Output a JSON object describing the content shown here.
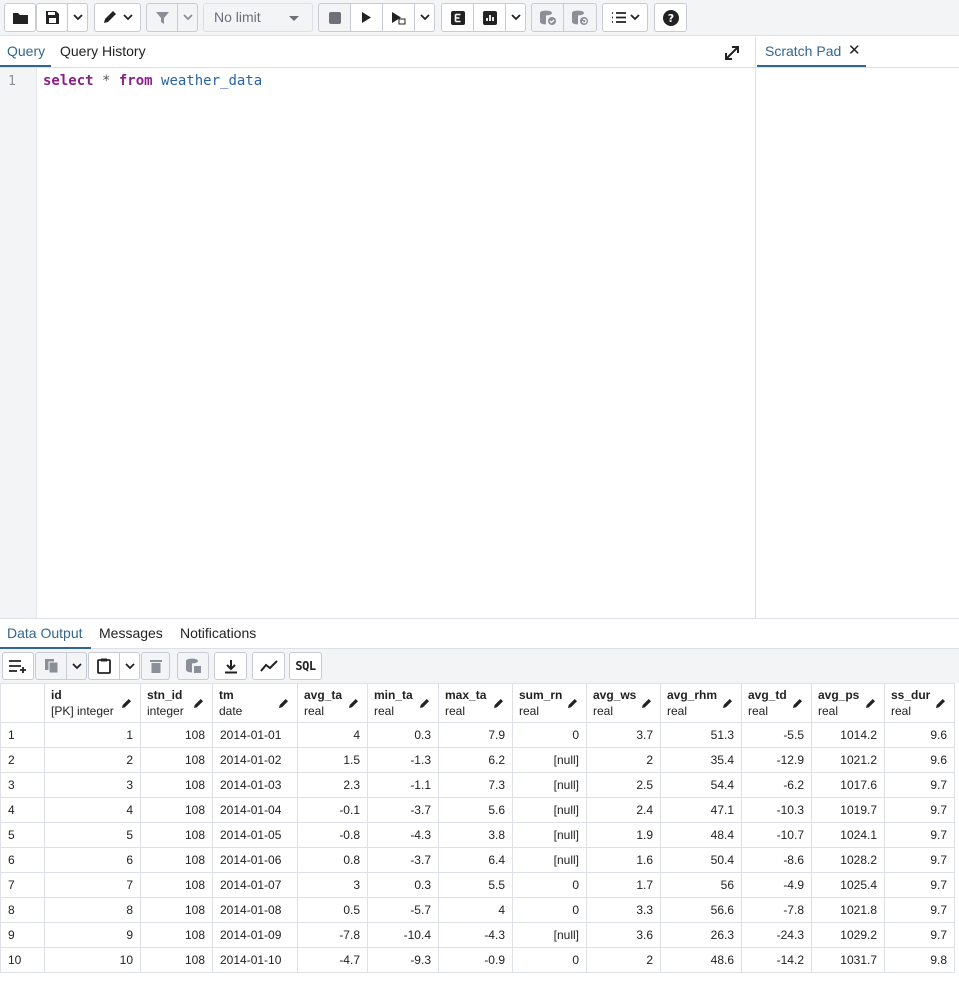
{
  "toolbar": {
    "limit_label": "No limit",
    "buttons": [
      "open-file-icon",
      "save-icon",
      "edit-icon",
      "filter-icon",
      "stop-icon",
      "execute-icon",
      "execute-script-icon",
      "explain-icon",
      "explain-analyze-icon",
      "commit-icon",
      "rollback-icon",
      "macros-icon",
      "help-icon"
    ]
  },
  "query": {
    "tabs": [
      "Query",
      "Query History"
    ],
    "line_number": "1",
    "code": {
      "kw1": "select",
      "op": " * ",
      "kw2": "from",
      "table": " weather_data"
    }
  },
  "scratch": {
    "title": "Scratch Pad",
    "close": "✕"
  },
  "output": {
    "tabs": [
      "Data Output",
      "Messages",
      "Notifications"
    ],
    "sql_button": "SQL"
  },
  "grid": {
    "columns": [
      {
        "name": "id",
        "type": "[PK] integer"
      },
      {
        "name": "stn_id",
        "type": "integer"
      },
      {
        "name": "tm",
        "type": "date"
      },
      {
        "name": "avg_ta",
        "type": "real"
      },
      {
        "name": "min_ta",
        "type": "real"
      },
      {
        "name": "max_ta",
        "type": "real"
      },
      {
        "name": "sum_rn",
        "type": "real"
      },
      {
        "name": "avg_ws",
        "type": "real"
      },
      {
        "name": "avg_rhm",
        "type": "real"
      },
      {
        "name": "avg_td",
        "type": "real"
      },
      {
        "name": "avg_ps",
        "type": "real"
      },
      {
        "name": "ss_dur",
        "type": "real"
      }
    ],
    "rows": [
      [
        "1",
        "1",
        "108",
        "2014-01-01",
        "4",
        "0.3",
        "7.9",
        "0",
        "3.7",
        "51.3",
        "-5.5",
        "1014.2",
        "9.6"
      ],
      [
        "2",
        "2",
        "108",
        "2014-01-02",
        "1.5",
        "-1.3",
        "6.2",
        "[null]",
        "2",
        "35.4",
        "-12.9",
        "1021.2",
        "9.6"
      ],
      [
        "3",
        "3",
        "108",
        "2014-01-03",
        "2.3",
        "-1.1",
        "7.3",
        "[null]",
        "2.5",
        "54.4",
        "-6.2",
        "1017.6",
        "9.7"
      ],
      [
        "4",
        "4",
        "108",
        "2014-01-04",
        "-0.1",
        "-3.7",
        "5.6",
        "[null]",
        "2.4",
        "47.1",
        "-10.3",
        "1019.7",
        "9.7"
      ],
      [
        "5",
        "5",
        "108",
        "2014-01-05",
        "-0.8",
        "-4.3",
        "3.8",
        "[null]",
        "1.9",
        "48.4",
        "-10.7",
        "1024.1",
        "9.7"
      ],
      [
        "6",
        "6",
        "108",
        "2014-01-06",
        "0.8",
        "-3.7",
        "6.4",
        "[null]",
        "1.6",
        "50.4",
        "-8.6",
        "1028.2",
        "9.7"
      ],
      [
        "7",
        "7",
        "108",
        "2014-01-07",
        "3",
        "0.3",
        "5.5",
        "0",
        "1.7",
        "56",
        "-4.9",
        "1025.4",
        "9.7"
      ],
      [
        "8",
        "8",
        "108",
        "2014-01-08",
        "0.5",
        "-5.7",
        "4",
        "0",
        "3.3",
        "56.6",
        "-7.8",
        "1021.8",
        "9.7"
      ],
      [
        "9",
        "9",
        "108",
        "2014-01-09",
        "-7.8",
        "-10.4",
        "-4.3",
        "[null]",
        "3.6",
        "26.3",
        "-24.3",
        "1029.2",
        "9.7"
      ],
      [
        "10",
        "10",
        "108",
        "2014-01-10",
        "-4.7",
        "-9.3",
        "-0.9",
        "0",
        "2",
        "48.6",
        "-14.2",
        "1031.7",
        "9.8"
      ]
    ]
  }
}
